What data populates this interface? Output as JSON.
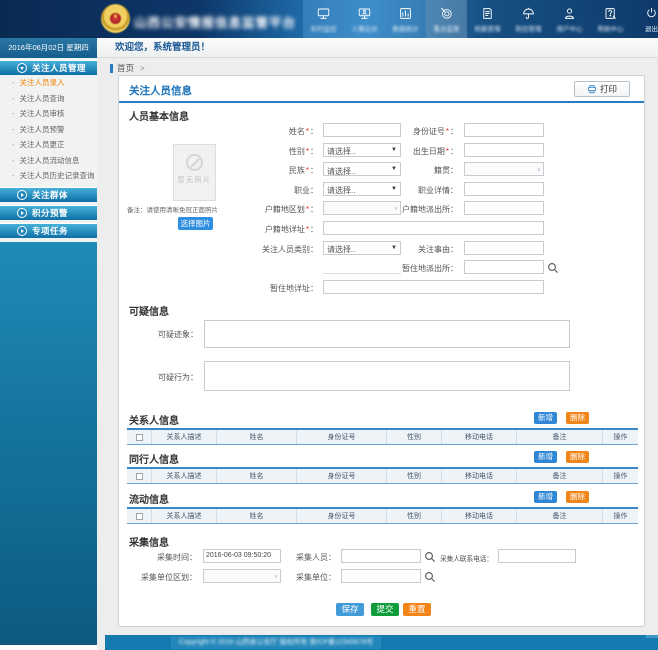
{
  "header": {
    "title": "山西公安情报信息监管平台",
    "title_blurred": true,
    "nav": [
      {
        "icon": "monitor",
        "label": "实时监控",
        "blurred": true,
        "active": false
      },
      {
        "icon": "monitor-user",
        "label": "人像比对",
        "blurred": true,
        "active": false
      },
      {
        "icon": "bar-chart",
        "label": "数据统计",
        "blurred": true,
        "active": false
      },
      {
        "icon": "target",
        "label": "重点监管",
        "blurred": true,
        "active": true
      },
      {
        "icon": "document",
        "label": "档案管理",
        "blurred": true,
        "active": false
      },
      {
        "icon": "umbrella",
        "label": "防控管理",
        "blurred": true,
        "active": false
      },
      {
        "icon": "user",
        "label": "用户中心",
        "blurred": true,
        "active": false
      },
      {
        "icon": "help-doc",
        "label": "帮助中心",
        "blurred": true,
        "active": false
      },
      {
        "icon": "power",
        "label": "退出",
        "blurred": false,
        "active": false
      }
    ]
  },
  "topbar": {
    "date": "2016年06月02日 星期四",
    "welcome": "欢迎您，系统管理员！"
  },
  "sidebar": {
    "groups": [
      {
        "label": "关注人员管理",
        "expanded": true,
        "items": [
          {
            "label": "关注人员录入",
            "active": true
          },
          {
            "label": "关注人员查询",
            "active": false
          },
          {
            "label": "关注人员审核",
            "active": false
          },
          {
            "label": "关注人员预警",
            "active": false
          },
          {
            "label": "关注人员更正",
            "active": false
          },
          {
            "label": "关注人员流动信息",
            "active": false
          },
          {
            "label": "关注人员历史记录查询",
            "active": false
          }
        ]
      },
      {
        "label": "关注群体",
        "expanded": false
      },
      {
        "label": "积分预警",
        "expanded": false
      },
      {
        "label": "专项任务",
        "expanded": false
      }
    ]
  },
  "breadcrumb": {
    "home": "首页",
    "separator": ">"
  },
  "panel": {
    "title": "关注人员信息",
    "print_label": "打印"
  },
  "basic": {
    "title": "人员基本信息",
    "photo": {
      "placeholder": "暂无照片",
      "note": "备注：请使用清晰免冠正面照片",
      "choose_label": "选择图片"
    },
    "rows": [
      {
        "left": {
          "label": "姓名",
          "required": true,
          "type": "text"
        },
        "right": {
          "label": "身份证号",
          "required": true,
          "type": "text"
        }
      },
      {
        "left": {
          "label": "性别",
          "required": true,
          "type": "select",
          "value": "请选择.."
        },
        "right": {
          "label": "出生日期",
          "required": true,
          "type": "text"
        }
      },
      {
        "left": {
          "label": "民族",
          "required": true,
          "type": "select",
          "value": "请选择.."
        },
        "right": {
          "label": "籍贯",
          "required": false,
          "type": "combo"
        }
      },
      {
        "left": {
          "label": "职业",
          "required": false,
          "type": "select",
          "value": "请选择.."
        },
        "right": {
          "label": "职业详情",
          "required": false,
          "type": "text"
        }
      },
      {
        "left": {
          "label": "户籍地区划",
          "required": true,
          "type": "combo"
        },
        "right": {
          "label": "户籍地派出所",
          "required": false,
          "type": "text"
        }
      },
      {
        "left": {
          "label": "户籍地详址",
          "required": true,
          "type": "text",
          "span": "long"
        }
      },
      {
        "left": {
          "label": "关注人员类别",
          "required": false,
          "type": "select",
          "value": "请选择.."
        },
        "right": {
          "label": "关注事由",
          "required": false,
          "type": "text"
        }
      },
      {
        "left": {
          "label": "",
          "required": false,
          "type": "line"
        },
        "right": {
          "label": "暂住地派出所",
          "required": false,
          "type": "text",
          "search": true
        }
      },
      {
        "left": {
          "label": "暂住地详址",
          "required": false,
          "type": "text",
          "span": "long"
        }
      }
    ]
  },
  "suspicious": {
    "title": "可疑信息",
    "fields": [
      {
        "label": "可疑迹象"
      },
      {
        "label": "可疑行为"
      }
    ]
  },
  "tables": {
    "headers": [
      "关系人描述",
      "姓名",
      "身份证号",
      "性别",
      "移动电话",
      "备注",
      "操作"
    ],
    "add_label": "新增",
    "delete_label": "删除",
    "sections": [
      {
        "title": "关系人信息"
      },
      {
        "title": "同行人信息"
      },
      {
        "title": "流动信息"
      }
    ]
  },
  "collect": {
    "title": "采集信息",
    "time_label": "采集时间",
    "time_value": "2016-06-03 09:50:20",
    "person_label": "采集人员",
    "phone_label": "采集人联系电话",
    "org_region_label": "采集单位区划",
    "org_label": "采集单位"
  },
  "actions": {
    "save": "保存",
    "submit": "提交",
    "reset": "重置"
  },
  "footer": {
    "text": "Copyright © 2016 山西省公安厅 版权所有 晋ICP备12345678号",
    "blurred": true
  },
  "colors": {
    "accent": "#1b72b8",
    "add_button": "#2e86d4",
    "delete_button": "#f08519",
    "save_button": "#429bd9",
    "submit_button": "#0f9c3a",
    "reset_button": "#f28418"
  }
}
